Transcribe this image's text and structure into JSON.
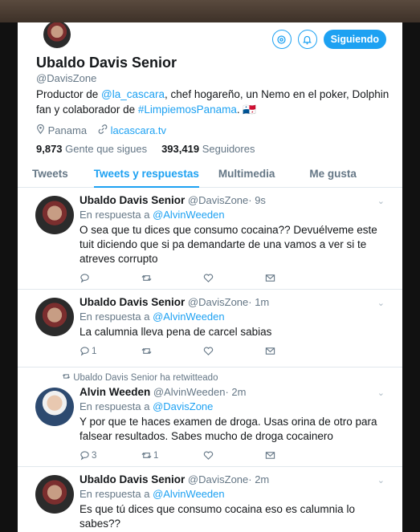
{
  "profile": {
    "name": "Ubaldo Davis Senior",
    "handle": "@DavisZone",
    "bio_prefix": "Productor de ",
    "bio_link1": "@la_cascara",
    "bio_mid": ", chef hogareño, un Nemo en el poker, Dolphin fan y colaborador de ",
    "bio_link2": "#LimpiemosPanama",
    "bio_suffix": ". 🇵🇦",
    "location": "Panama",
    "website": "lacascara.tv",
    "following_count": "9,873",
    "following_label": "Gente que sigues",
    "followers_count": "393,419",
    "followers_label": "Seguidores",
    "follow_button": "Siguiendo"
  },
  "tabs": [
    {
      "label": "Tweets"
    },
    {
      "label": "Tweets y respuestas"
    },
    {
      "label": "Multimedia"
    },
    {
      "label": "Me gusta"
    }
  ],
  "tweets": [
    {
      "name": "Ubaldo Davis Senior",
      "handle": "@DavisZone",
      "time": "· 9s",
      "reply_prefix": "En respuesta a ",
      "reply_to": "@AlvinWeeden",
      "text": "O sea que tu dices que consumo cocaina?? Devuélveme este tuit diciendo que si pa demandarte de una vamos a ver si te atreves corrupto",
      "reply_count": "",
      "rt_count": ""
    },
    {
      "name": "Ubaldo Davis Senior",
      "handle": "@DavisZone",
      "time": "· 1m",
      "reply_prefix": "En respuesta a ",
      "reply_to": "@AlvinWeeden",
      "text": "La calumnia lleva pena de carcel sabias",
      "reply_count": "1",
      "rt_count": ""
    },
    {
      "retweet_note": "Ubaldo Davis Senior ha retwitteado",
      "name": "Alvin Weeden",
      "handle": "@AlvinWeeden",
      "time": "· 2m",
      "reply_prefix": "En respuesta a ",
      "reply_to": "@DavisZone",
      "text": "Y por que te haces examen de droga. Usas orina de otro para falsear resultados. Sabes mucho de droga cocainero",
      "reply_count": "3",
      "rt_count": "1"
    },
    {
      "name": "Ubaldo Davis Senior",
      "handle": "@DavisZone",
      "time": "· 2m",
      "reply_prefix": "En respuesta a ",
      "reply_to": "@AlvinWeeden",
      "text": "Es que tú dices que consumo cocaina eso es calumnia lo sabes??",
      "reply_count": "",
      "rt_count": ""
    }
  ]
}
